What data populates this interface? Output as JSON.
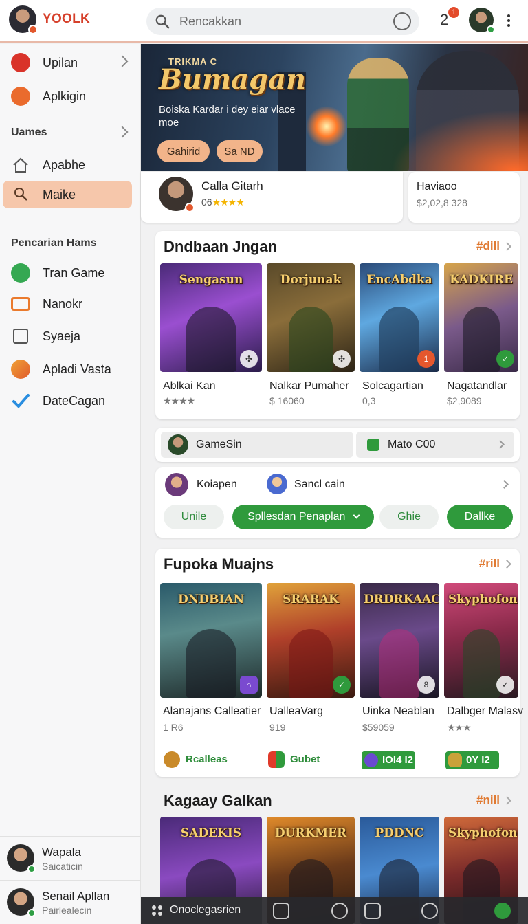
{
  "header": {
    "brand": "YOOLK",
    "search_placeholder": "Rencakkan",
    "notif_count": "2",
    "notif_badge": "1"
  },
  "sidebar": {
    "items_top": [
      {
        "label": "Upilan",
        "icon": "red-circle-icon"
      },
      {
        "label": "Aplkigin",
        "icon": "orange-r-icon"
      }
    ],
    "group1": "Uames",
    "items_mid": [
      {
        "label": "Apabhe",
        "icon": "home-icon"
      },
      {
        "label": "Maike",
        "icon": "search-person-icon"
      }
    ],
    "group2": "Pencarian Hams",
    "items_bottom": [
      {
        "label": "Tran Game",
        "icon": "chat-bubble-icon"
      },
      {
        "label": "Nanokr",
        "icon": "controller-icon"
      },
      {
        "label": "Syaeja",
        "icon": "square-icon"
      },
      {
        "label": "Apladi Vasta",
        "icon": "brush-icon"
      },
      {
        "label": "DateCagan",
        "icon": "check-icon"
      }
    ],
    "users": [
      {
        "name": "Wapala",
        "sub": "Saicaticin"
      },
      {
        "name": "Senail Apllan",
        "sub": "Pairlealecin"
      }
    ]
  },
  "hero": {
    "kicker": "TRIKMA C",
    "title": "Bumagan",
    "desc": "Boiska Kardar i dey eiar vlace moe",
    "btn1": "Gahirid",
    "btn2": "Sa ND"
  },
  "profile": {
    "name": "Calla Gitarh",
    "score": "06",
    "stars": "★★★★",
    "right_name": "Haviaoo",
    "right_value": "$2,02,8 328"
  },
  "section1": {
    "title": "Dndbaan Jngan",
    "more": "#dill",
    "tiles": [
      {
        "art_title": "Sengasun",
        "name": "Ablkai Kan",
        "sub": "★★★★",
        "corner": "✣"
      },
      {
        "art_title": "Dorjunak",
        "name": "Nalkar Pumaher",
        "sub": "$ 16060",
        "corner": "✣"
      },
      {
        "art_title": "EncAbdka",
        "name": "Solcagartian",
        "sub": "0,3",
        "corner": "1"
      },
      {
        "art_title": "KADKIRE",
        "name": "Nagatandlar",
        "sub": "$2,9089",
        "corner": "✓"
      }
    ]
  },
  "strip": {
    "left_label": "GameSin",
    "right_label": "Mato C00"
  },
  "filters": {
    "user1": "Koiapen",
    "user2": "Sancl cain",
    "pills": [
      "Unile",
      "Spllesdan Penaplan",
      "Ghie",
      "Dallke"
    ]
  },
  "section2": {
    "title": "Fupoka Muajns",
    "more": "#rill",
    "tiles": [
      {
        "art_title": "DNDBIAN",
        "name": "Alanajans Calleatier",
        "sub": "1 R6",
        "corner": "⌂"
      },
      {
        "art_title": "SRARAK",
        "name": "UalleaVarg",
        "sub": "919",
        "corner": "✓"
      },
      {
        "art_title": "DRDRKAACH",
        "name": "Uinka Neablan",
        "sub": "$59059",
        "corner": "8"
      },
      {
        "art_title": "Skyphofond",
        "name": "Dalbger Malasv",
        "sub": "★★★",
        "corner": "✓"
      }
    ],
    "tags": [
      "Rcalleas",
      "Gubet",
      "IOI4 I2",
      "0Y I2"
    ]
  },
  "section3": {
    "title": "Kagaay Galkan",
    "more": "#nill",
    "tiles": [
      {
        "art_title": "SADEKIS"
      },
      {
        "art_title": "DURKMER"
      },
      {
        "art_title": "PDDNC"
      },
      {
        "art_title": "Skyphofond"
      }
    ]
  },
  "dock": {
    "label": "Onoclegasrien"
  }
}
